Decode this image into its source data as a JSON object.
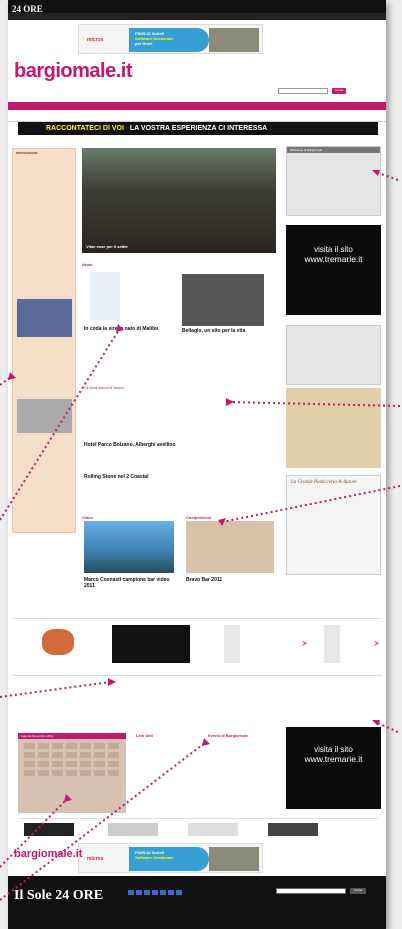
{
  "header": {
    "logo": "24 ORE",
    "nav_top": [
      "",
      "",
      "",
      "",
      "",
      "",
      "",
      ""
    ],
    "nav_sub": []
  },
  "banner": {
    "brand": "micros",
    "fidelio": "FIDELIO Suite8",
    "fidelio_sub": "Software Gestionale",
    "fidelio_sub2": "per Hotel"
  },
  "site": {
    "title": "bargiomale.it",
    "search_button": "Cerca"
  },
  "promo": {
    "left": "RACCONTATECI DI VOI",
    "right": "LA VOSTRA ESPERIENZA CI INTERESSA"
  },
  "sidebar": {
    "title": "PROFESSIONE"
  },
  "hero": {
    "caption": "Vitae esse per il settle"
  },
  "news": {
    "section": "News",
    "story1_title": "In coda la sirena nato di Malibu",
    "story2_title": "Bellagio, un sito per la vita",
    "more": "Gli ultimi articoli di Newse",
    "mid_title": "Hotel Parco Bolzano, Alberghi avellino",
    "mid_title2": "Rolling Stone nel 2 Coastal"
  },
  "video": {
    "section": "Video",
    "caption": "Marco Cosnasti campione bar video 2011"
  },
  "competizioni": {
    "section": "Competizioni",
    "caption": "Bravo Bar 2011"
  },
  "ad": {
    "visita": "visita il sito",
    "url": "www.tremarie.it"
  },
  "right": {
    "title_top": "Biblioteca di Bargiornale",
    "title_right": "La Grande Pasticceria & Autore"
  },
  "bottom": {
    "calendar_title": "Agenda Novembre 2011",
    "list_title": "Link Utili",
    "events_title": "Eventi di Bargiornale"
  },
  "footer": {
    "logo": "Il Sole 24 ORE",
    "search_button": "Cerca"
  },
  "colors": {
    "brand": "#c2186e",
    "accent": "#d0146e"
  }
}
